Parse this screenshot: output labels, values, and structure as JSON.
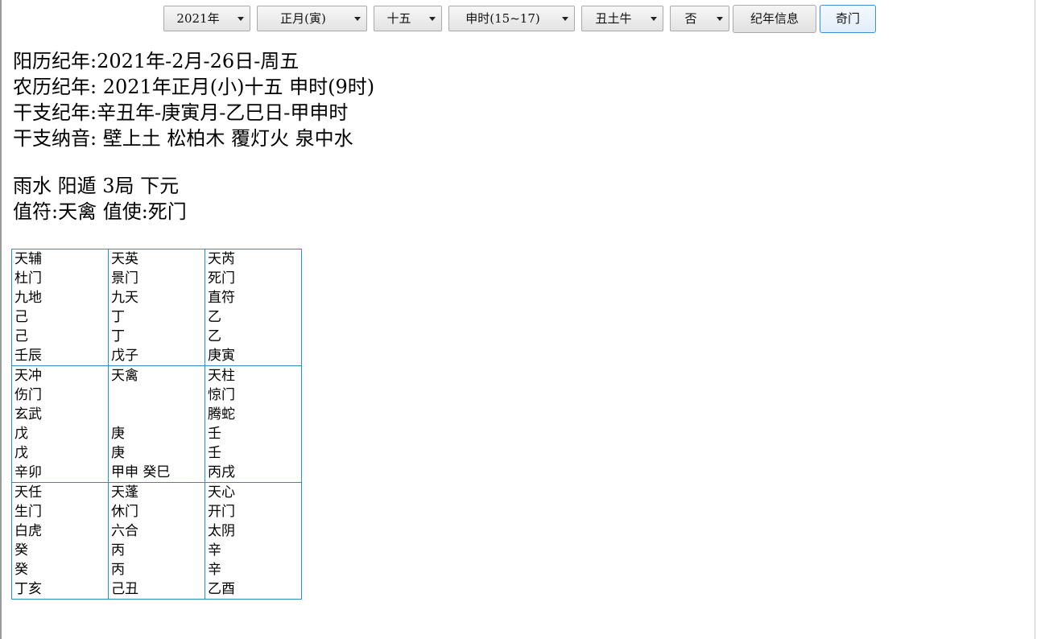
{
  "toolbar": {
    "year": "2021年",
    "month": "正月(寅)",
    "day": "十五",
    "hour": "申时(15~17)",
    "zodiac": "丑土牛",
    "leap": "否",
    "info_button": "纪年信息",
    "qimen_button": "奇门"
  },
  "info": {
    "solar": "阳历纪年:2021年-2月-26日-周五",
    "lunar": "农历纪年: 2021年正月(小)十五 申时(9时)",
    "ganzhi": "干支纪年:辛丑年-庚寅月-乙巳日-甲申时",
    "nayin": "干支纳音: 壁上土 松柏木 覆灯火 泉中水",
    "jieqi": "雨水 阳遁 3局 下元",
    "zhifu": "值符:天禽 值使:死门"
  },
  "grid": [
    [
      [
        "天辅",
        "杜门",
        "九地",
        "己",
        "己",
        "壬辰"
      ],
      [
        "天英",
        "景门",
        "九天",
        "丁",
        "丁",
        "戊子"
      ],
      [
        "天芮",
        "死门",
        "直符",
        "乙",
        "乙",
        "庚寅"
      ]
    ],
    [
      [
        "天冲",
        "伤门",
        "玄武",
        "戊",
        "戊",
        "辛卯"
      ],
      [
        "天禽",
        "",
        "",
        "庚",
        "庚",
        "甲申 癸巳"
      ],
      [
        "天柱",
        "惊门",
        "腾蛇",
        "壬",
        "壬",
        "丙戌"
      ]
    ],
    [
      [
        "天任",
        "生门",
        "白虎",
        "癸",
        "癸",
        "丁亥"
      ],
      [
        "天蓬",
        "休门",
        "六合",
        "丙",
        "丙",
        "己丑"
      ],
      [
        "天心",
        "开门",
        "太阴",
        "辛",
        "辛",
        "乙酉"
      ]
    ]
  ]
}
